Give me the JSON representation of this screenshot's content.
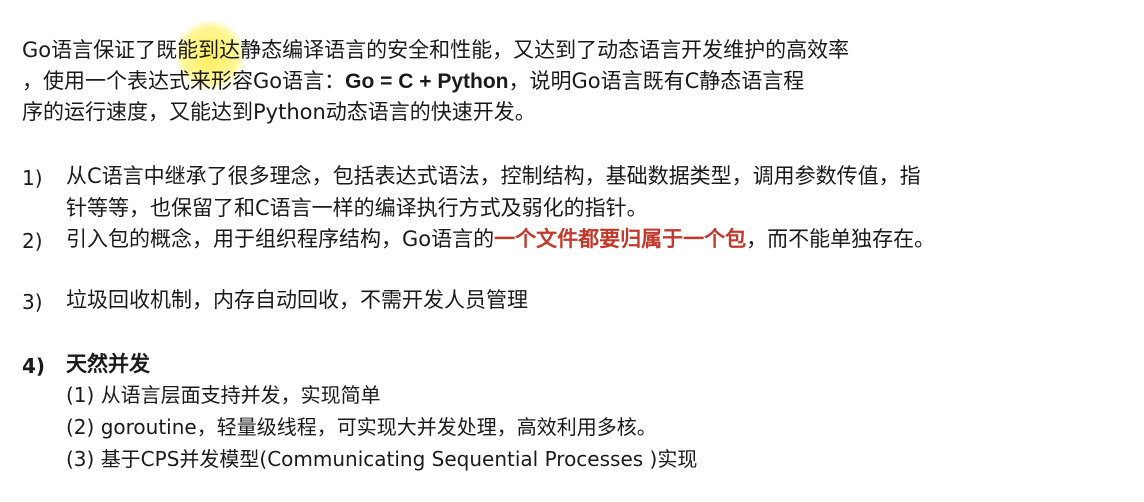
{
  "intro": {
    "line1": "Go语言保证了既能到达静态编译语言的安全和性能，又达到了动态语言开发维护的高效率",
    "line2_pre": "，使用一个表达式来形容Go语言：",
    "line2_formula": "Go = C + Python",
    "line2_post": "，说明Go语言既有C静态语言程",
    "line3": "序的运行速度，又能达到Python动态语言的快速开发。"
  },
  "items": [
    {
      "num": "1)",
      "line1": "从C语言中继承了很多理念，包括表达式语法，控制结构，基础数据类型，调用参数传值，指",
      "line2": "针等等，也保留了和C语言一样的编译执行方式及弱化的指针。"
    },
    {
      "num": "2)",
      "pre": "引入包的概念，用于组织程序结构，Go语言的",
      "highlight": "一个文件都要归属于一个包",
      "post": "，而不能单独存在。"
    },
    {
      "num": "3)",
      "line1": "垃圾回收机制，内存自动回收，不需开发人员管理"
    },
    {
      "num": "4)",
      "title": "天然并发",
      "subs": [
        "(1) 从语言层面支持并发，实现简单",
        "(2) goroutine，轻量级线程，可实现大并发处理，高效利用多核。",
        "(3) 基于CPS并发模型(Communicating Sequential Processes )实现"
      ]
    }
  ],
  "colors": {
    "text": "#1a1a1a",
    "highlight_red": "#c0392b",
    "cursor_yellow": "#ffeb3c"
  }
}
